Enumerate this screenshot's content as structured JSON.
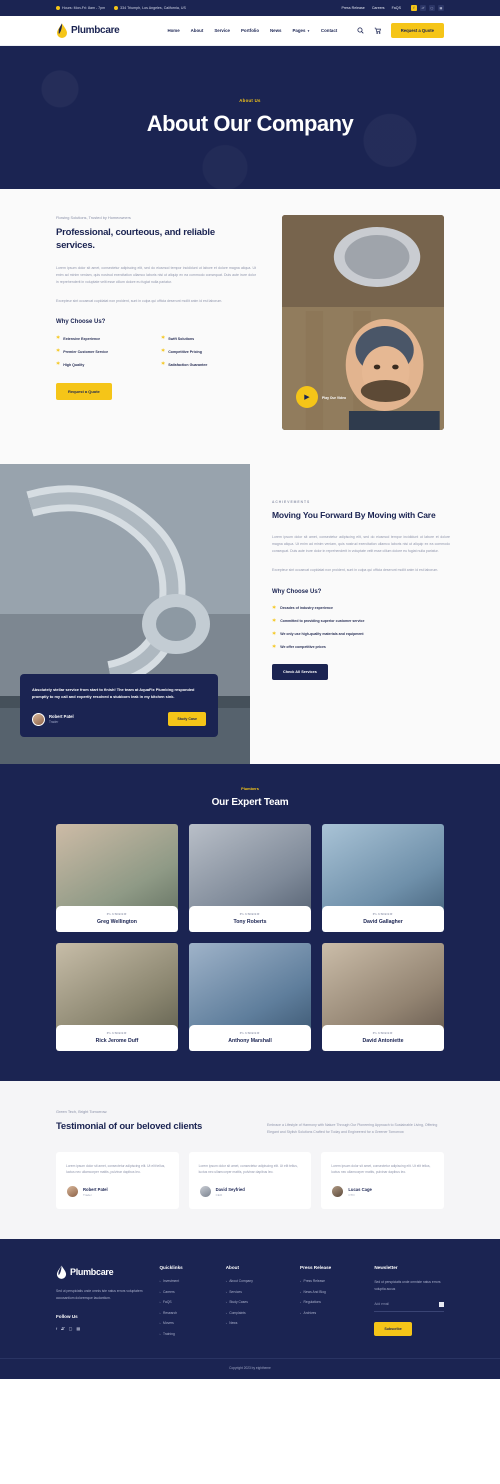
{
  "topbar": {
    "hours": "Hours: Mon-Fri: 8am - 7pm",
    "address": "334 Triumph, Los Angeles, California, US",
    "links": [
      "Press Release",
      "Careers",
      "FaQS"
    ],
    "socials": [
      "facebook-icon",
      "twitter-icon",
      "instagram-icon",
      "linkedin-icon"
    ]
  },
  "header": {
    "logo": "Plumbcare",
    "nav": [
      {
        "label": "Home",
        "caret": false
      },
      {
        "label": "About",
        "caret": false
      },
      {
        "label": "Service",
        "caret": false
      },
      {
        "label": "Portfolio",
        "caret": false
      },
      {
        "label": "News",
        "caret": false
      },
      {
        "label": "Pages",
        "caret": true
      },
      {
        "label": "Contact",
        "caret": false
      }
    ],
    "search_icon": "search-icon",
    "cart_icon": "cart-icon",
    "cta": "Request a Quote"
  },
  "hero": {
    "label": "About Us",
    "title": "About Our Company"
  },
  "about": {
    "eyebrow": "Flowing Solutions, Trusted by Homeowners",
    "title": "Professional, courteous, and reliable services.",
    "paragraph1": "Lorem ipsum dolor sit amet, consectetur adipiscing elit, sed do eiusmod tempor incididunt ut labore et dolore magna aliqua. Ut enim ad minim veniam, quis nostrud exercitation ullamco laboris nisi ut aliquip ex ea commodo consequat. Duis aute irure dolor in reprehenderit in voluptate velit esse cillum dolore eu fugiat nulla pariatur.",
    "paragraph2": "Excepteur sint occaecat cupidatat non proident, sunt in culpa qui officia deserunt mollit anim id est laborum.",
    "why_title": "Why Choose Us?",
    "features": [
      "Extensive Experience",
      "Swift Solutions",
      "Premier Customer Service",
      "Competitive Pricing",
      "High Quality",
      "Satisfaction Guarantee"
    ],
    "cta": "Request a Quote",
    "play_label": "Play Our Video",
    "play_icon": "play-icon"
  },
  "achievements": {
    "eyebrow": "ACHIEVEMENTS",
    "title": "Moving You Forward By Moving with Care",
    "paragraph1": "Lorem ipsum dolor sit amet, consectetur adipiscing elit, sed do eiusmod tempor incididunt ut labore et dolore magna aliqua. Ut enim ad minim veniam, quis nostrud exercitation ullamco laboris nisi ut aliquip ex ea commodo consequat. Duis aute irure dolor in reprehenderit in voluptate velit esse cillum dolore eu fugiat nulla pariatur.",
    "paragraph2": "Excepteur sint occaecat cupidatat non proident, sunt in culpa qui officia deserunt mollit anim id est laborum.",
    "why_title": "Why Choose Us?",
    "checks": [
      "Decades of industry experience",
      "Committed to providing superior customer service",
      "We only use high-quality materials and equipment",
      "We offer competitive prices"
    ],
    "cta": "Check All Services"
  },
  "feature_testimonial": {
    "quote": "Absolutely stellar service from start to finish! The team at AquaFix Plumbing responded promptly to my call and expertly resolved a stubborn leak in my kitchen sink.",
    "name": "Robert Patel",
    "role": "Trader",
    "cta": "Study Case"
  },
  "team": {
    "label": "Plumbers",
    "title": "Our Expert Team",
    "members": [
      {
        "role": "PLUMBER",
        "name": "Greg Wellington",
        "photo": "ph-a"
      },
      {
        "role": "PLUMBER",
        "name": "Tony Roberts",
        "photo": "ph-b"
      },
      {
        "role": "PLUMBER",
        "name": "David Gallagher",
        "photo": "ph-c"
      },
      {
        "role": "PLUMBER",
        "name": "Rick Jerome Duff",
        "photo": "ph-d"
      },
      {
        "role": "PLUMBER",
        "name": "Anthony Marshall",
        "photo": "ph-e"
      },
      {
        "role": "PLUMBER",
        "name": "David Antoniette",
        "photo": "ph-f"
      }
    ]
  },
  "testimonials": {
    "eyebrow": "Green Tech, Bright Tomorrow.",
    "title": "Testimonial of our beloved clients",
    "intro": "Embrace a Lifestyle of Harmony with Nature Through Our Pioneering Approach to Sustainable Living, Offering Elegant and Stylish Solutions Crafted for Today and Engineered for a Greener Tomorrow",
    "cards": [
      {
        "text": "Lorem ipsum dolor sit amet, consectetur adipiscing elit. Ut elit tellus, luctus nec ullamcorper mattis, pulvinar dapibus leo.",
        "name": "Robert Patel",
        "role": "Trader",
        "avatar": "av-a"
      },
      {
        "text": "Lorem ipsum dolor sit amet, consectetur adipiscing elit. Ut elit tellus, luctus nec ullamcorper mattis, pulvinar dapibus leo.",
        "name": "David Seyfried",
        "role": "CEO",
        "avatar": "av-b"
      },
      {
        "text": "Lorem ipsum dolor sit amet, consectetur adipiscing elit. Ut elit tellus, luctus nec ullamcorper mattis, pulvinar dapibus leo.",
        "name": "Lucas Cage",
        "role": "CTO",
        "avatar": "av-c"
      }
    ]
  },
  "footer": {
    "logo": "Plumbcare",
    "description": "Sed ut perspiciatis unde omnis iste natus errors voluptatem accusantium doloremque laudantium.",
    "follow_title": "Follow Us",
    "socials": [
      "facebook-icon",
      "twitter-icon",
      "instagram-icon",
      "linkedin-icon"
    ],
    "columns": [
      {
        "title": "Quicklinks",
        "items": [
          "Investment",
          "Careers",
          "FaQS",
          "Research",
          "Movers",
          "Training"
        ]
      },
      {
        "title": "About",
        "items": [
          "About Company",
          "Services",
          "Study Cases",
          "Complaints",
          "News"
        ]
      },
      {
        "title": "Press Release",
        "items": [
          "Press Release",
          "News And Blog",
          "Regulations",
          "Archives"
        ]
      }
    ],
    "newsletter": {
      "title": "Newsletter",
      "description": "Sed ut perspiciatis unde omniste natus errors voluptia accus",
      "placeholder": "Add email",
      "cta": "Subscribe"
    },
    "copyright": "Copyright 2023 by eightheme"
  },
  "colors": {
    "navy": "#1b2452",
    "yellow": "#f5c518",
    "light": "#fafafa"
  }
}
